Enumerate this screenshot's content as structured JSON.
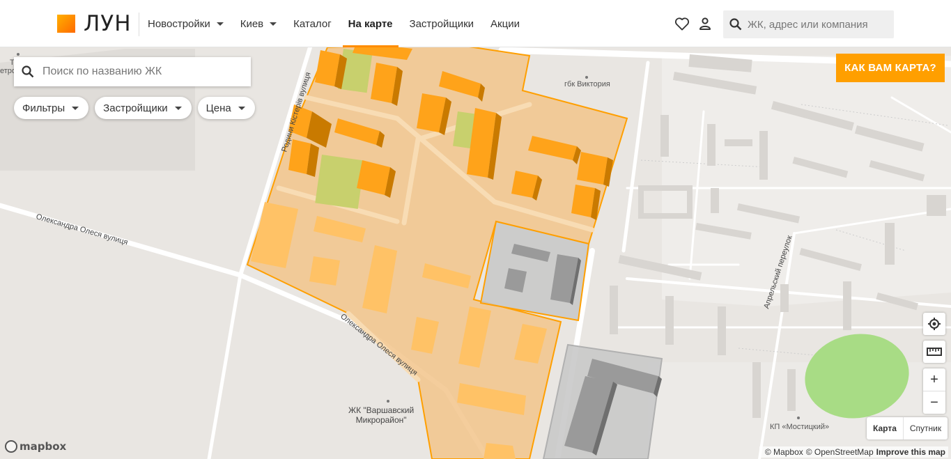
{
  "header": {
    "logo_text": "ЛУН",
    "nav": [
      {
        "label": "Новостройки",
        "dropdown": true,
        "active": false
      },
      {
        "label": "Киев",
        "dropdown": true,
        "active": false
      },
      {
        "label": "Каталог",
        "dropdown": false,
        "active": false
      },
      {
        "label": "На карте",
        "dropdown": false,
        "active": true
      },
      {
        "label": "Застройщики",
        "dropdown": false,
        "active": false
      },
      {
        "label": "Акции",
        "dropdown": false,
        "active": false
      }
    ],
    "icons": [
      "heart-icon",
      "user-icon"
    ],
    "search_placeholder": "ЖК, адрес или компания"
  },
  "map_search": {
    "placeholder": "Поиск по названию ЖК"
  },
  "filters": [
    {
      "label": "Фильтры"
    },
    {
      "label": "Застройщики"
    },
    {
      "label": "Цена"
    }
  ],
  "feedback_button": "КАК ВАМ КАРТА?",
  "map_controls": [
    "geolocate-icon",
    "ruler-icon",
    "zoom-in-icon",
    "zoom-out-icon"
  ],
  "zoom_in_label": "+",
  "zoom_out_label": "−",
  "map_style": {
    "options": [
      "Карта",
      "Спутник"
    ],
    "selected": "Карта"
  },
  "map_labels": {
    "poi_1": "гбк Виктория",
    "poi_2_line1": "ЖК \"Варшавский",
    "poi_2_line2": "Микрорайон\"",
    "poi_3": "КП «Мостицкий»",
    "edge_1": "Т",
    "edge_2": "етро"
  },
  "road_labels": {
    "road_1": "Родини Кістерів вулиця",
    "road_2": "Олександра Олеся вулиця",
    "road_3": "Олександра Олеся вулиця",
    "road_4": "Апрельский переулок"
  },
  "attribution": {
    "mapbox": "© Mapbox",
    "osm": "© OpenStreetMap",
    "improve": "Improve this map"
  },
  "mapbox_logo": "mapbox",
  "colors": {
    "accent": "#ff9f00",
    "zone_fill": "#f2c48b",
    "building": "#ffa31a",
    "park": "#a8dc85"
  }
}
